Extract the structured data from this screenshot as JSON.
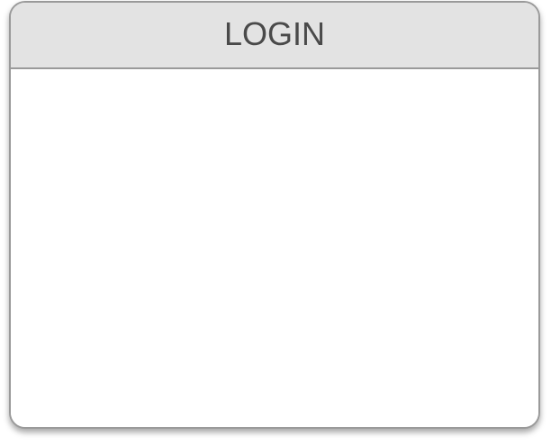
{
  "window": {
    "title": "LOGIN"
  },
  "colors": {
    "title_bar": "#e3e3e3",
    "border": "#9a9a9a",
    "title_text": "#4a4a4a",
    "content_bg": "#ffffff"
  }
}
